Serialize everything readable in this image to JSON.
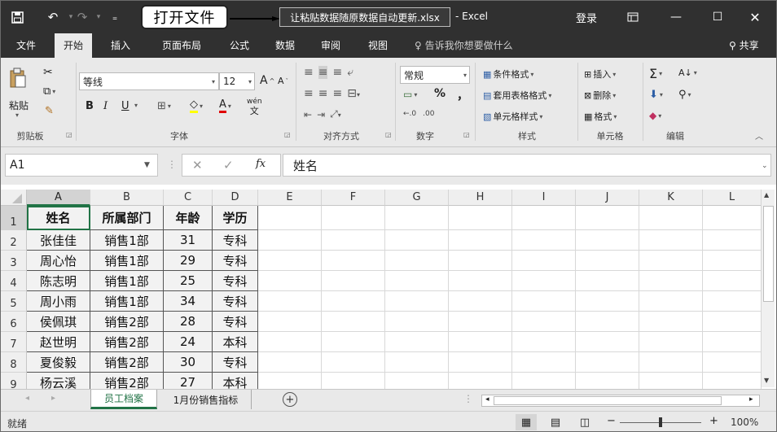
{
  "titlebar": {
    "callout": "打开文件",
    "filename": "让粘贴数据随原数据自动更新.xlsx",
    "app": "- Excel",
    "login": "登录"
  },
  "tabs": [
    "文件",
    "开始",
    "插入",
    "页面布局",
    "公式",
    "数据",
    "审阅",
    "视图"
  ],
  "tell_me": "告诉我你想要做什么",
  "share": "共享",
  "ribbon": {
    "clipboard": {
      "paste": "粘贴",
      "label": "剪贴板"
    },
    "font": {
      "name": "等线",
      "size": "12",
      "label": "字体",
      "bold": "B",
      "italic": "I",
      "underline": "U",
      "grow": "A",
      "shrink": "A",
      "phonetic": "wén"
    },
    "align": {
      "label": "对齐方式"
    },
    "number": {
      "format": "常规",
      "percent": "%",
      "comma": "，",
      "label": "数字"
    },
    "styles": {
      "cond": "条件格式",
      "table": "套用表格格式",
      "cell": "单元格样式",
      "label": "样式"
    },
    "cells": {
      "insert": "插入",
      "delete": "删除",
      "format": "格式",
      "label": "单元格"
    },
    "editing": {
      "label": "编辑"
    }
  },
  "formula": {
    "namebox": "A1",
    "fx": "fx",
    "value": "姓名"
  },
  "columns": [
    "A",
    "B",
    "C",
    "D",
    "E",
    "F",
    "G",
    "H",
    "I",
    "J",
    "K",
    "L"
  ],
  "rows": [
    "1",
    "2",
    "3",
    "4",
    "5",
    "6",
    "7",
    "8",
    "9"
  ],
  "table": [
    [
      "姓名",
      "所属部门",
      "年龄",
      "学历"
    ],
    [
      "张佳佳",
      "销售1部",
      "31",
      "专科"
    ],
    [
      "周心怡",
      "销售1部",
      "29",
      "专科"
    ],
    [
      "陈志明",
      "销售1部",
      "25",
      "专科"
    ],
    [
      "周小雨",
      "销售1部",
      "34",
      "专科"
    ],
    [
      "侯佩琪",
      "销售2部",
      "28",
      "专科"
    ],
    [
      "赵世明",
      "销售2部",
      "24",
      "本科"
    ],
    [
      "夏俊毅",
      "销售2部",
      "30",
      "专科"
    ],
    [
      "杨云溪",
      "销售2部",
      "27",
      "本科"
    ]
  ],
  "sheets": [
    "员工档案",
    "1月份销售指标"
  ],
  "status": {
    "ready": "就绪",
    "zoom": "100%"
  }
}
